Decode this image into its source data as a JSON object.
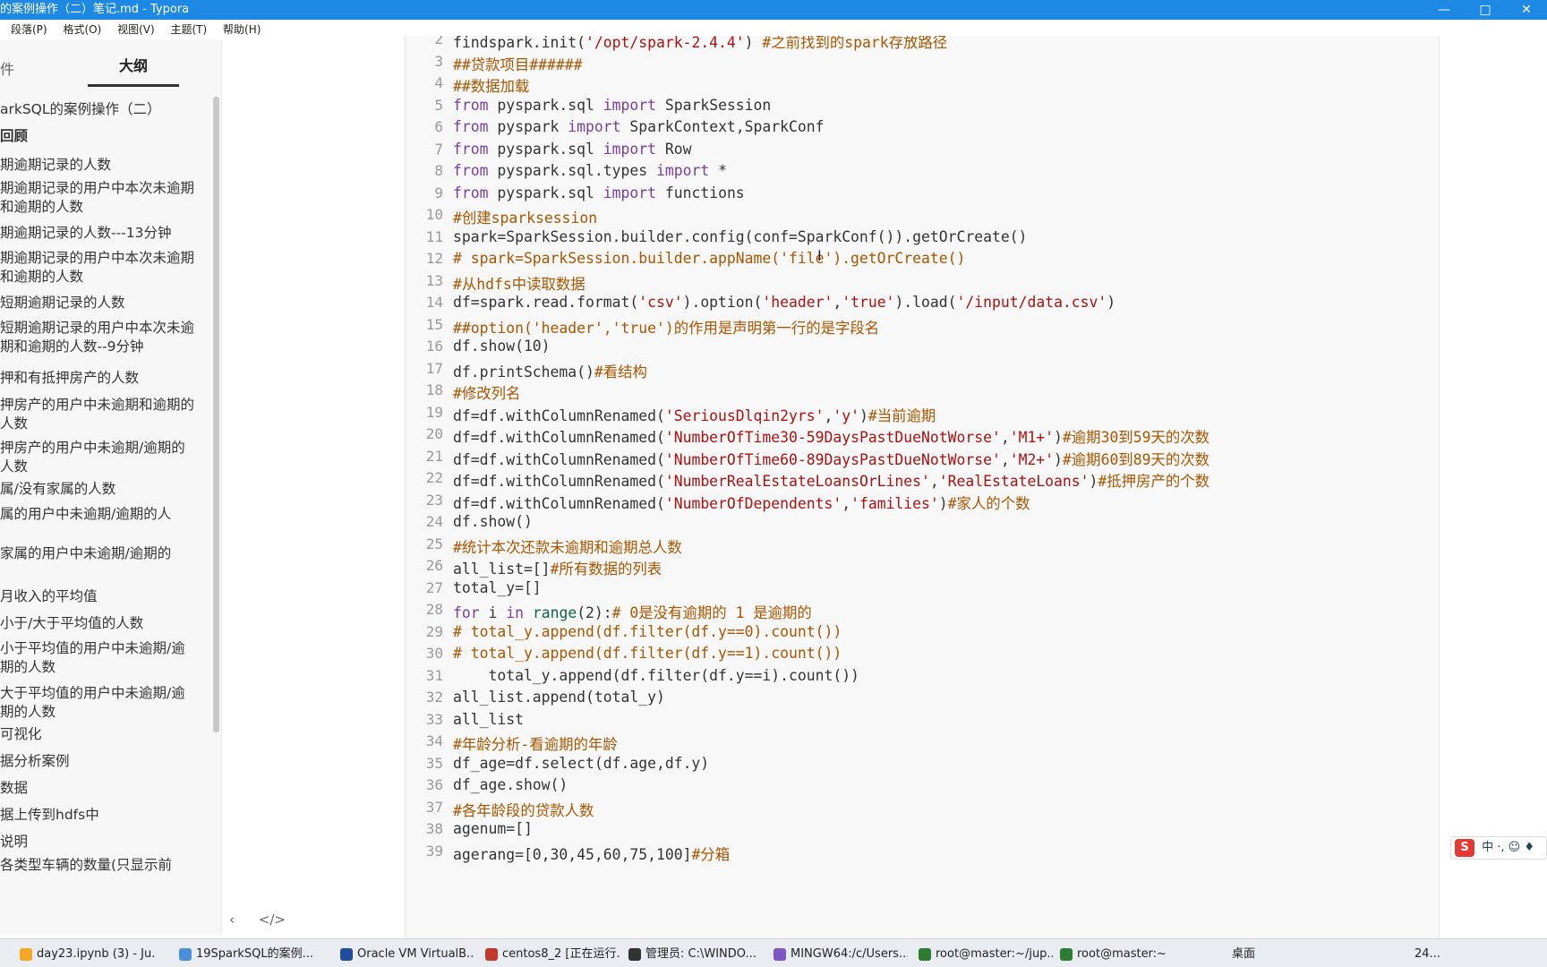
{
  "window": {
    "title": "的案例操作（二）笔记.md - Typora",
    "controls": [
      "—",
      "□",
      "✕"
    ]
  },
  "menu": [
    "段落(P)",
    "格式(O)",
    "视图(V)",
    "主题(T)",
    "帮助(H)"
  ],
  "sidebar": {
    "tab_files": "件",
    "tab_outline": "大纲",
    "items": [
      "arkSQL的案例操作（二）",
      "回顾",
      "期逾期记录的人数",
      "期逾期记录的用户中本次未逾期和逾期的人数",
      "期逾期记录的人数---13分钟",
      "期逾期记录的用户中本次未逾期和逾期的人数",
      "短期逾期记录的人数",
      "短期逾期记录的用户中本次未逾期和逾期的人数--9分钟",
      "押和有抵押房产的人数",
      "押房产的用户中未逾期和逾期的人数",
      "押房产的用户中未逾期/逾期的人数",
      "属/没有家属的人数",
      "属的用户中未逾期/逾期的人",
      "家属的用户中未逾期/逾期的",
      "月收入的平均值",
      "小于/大于平均值的人数",
      "小于平均值的用户中未逾期/逾期的人数",
      "大于平均值的用户中未逾期/逾期的人数",
      "可视化",
      "据分析案例",
      "数据",
      "据上传到hdfs中",
      "说明",
      "各类型车辆的数量(只显示前"
    ],
    "bottom_left": "‹",
    "bottom_source": "</>"
  },
  "editor": {
    "lines": [
      {
        "n": "2",
        "t": "findspark.init('/opt/spark-2.4.4') #之前找到的spark存放路径"
      },
      {
        "n": "3",
        "t": "##贷款项目######"
      },
      {
        "n": "4",
        "t": "##数据加载"
      },
      {
        "n": "5",
        "t": "from pyspark.sql import SparkSession"
      },
      {
        "n": "6",
        "t": "from pyspark import SparkContext,SparkConf"
      },
      {
        "n": "7",
        "t": "from pyspark.sql import Row"
      },
      {
        "n": "8",
        "t": "from pyspark.sql.types import *"
      },
      {
        "n": "9",
        "t": "from pyspark.sql import functions"
      },
      {
        "n": "10",
        "t": "#创建sparksession"
      },
      {
        "n": "11",
        "t": "spark=SparkSession.builder.config(conf=SparkConf()).getOrCreate()"
      },
      {
        "n": "12",
        "t": "# spark=SparkSession.builder.appName('file').getOrCreate()"
      },
      {
        "n": "13",
        "t": "#从hdfs中读取数据"
      },
      {
        "n": "14",
        "t": "df=spark.read.format('csv').option('header','true').load('/input/data.csv')"
      },
      {
        "n": "15",
        "t": "##option('header','true')的作用是声明第一行的是字段名"
      },
      {
        "n": "16",
        "t": "df.show(10)"
      },
      {
        "n": "17",
        "t": "df.printSchema()#看结构"
      },
      {
        "n": "18",
        "t": "#修改列名"
      },
      {
        "n": "19",
        "t": "df=df.withColumnRenamed('SeriousDlqin2yrs','y')#当前逾期"
      },
      {
        "n": "20",
        "t": "df=df.withColumnRenamed('NumberOfTime30-59DaysPastDueNotWorse','M1+')#逾期30到59天的次数"
      },
      {
        "n": "21",
        "t": "df=df.withColumnRenamed('NumberOfTime60-89DaysPastDueNotWorse','M2+')#逾期60到89天的次数"
      },
      {
        "n": "22",
        "t": "df=df.withColumnRenamed('NumberRealEstateLoansOrLines','RealEstateLoans')#抵押房产的个数"
      },
      {
        "n": "23",
        "t": "df=df.withColumnRenamed('NumberOfDependents','families')#家人的个数"
      },
      {
        "n": "24",
        "t": "df.show()"
      },
      {
        "n": "25",
        "t": "#统计本次还款未逾期和逾期总人数"
      },
      {
        "n": "26",
        "t": "all_list=[]#所有数据的列表"
      },
      {
        "n": "27",
        "t": "total_y=[]"
      },
      {
        "n": "28",
        "t": "for i in range(2):# 0是没有逾期的 1 是逾期的"
      },
      {
        "n": "29",
        "t": "# total_y.append(df.filter(df.y==0).count())"
      },
      {
        "n": "30",
        "t": "# total_y.append(df.filter(df.y==1).count())"
      },
      {
        "n": "31",
        "t": "    total_y.append(df.filter(df.y==i).count())"
      },
      {
        "n": "32",
        "t": "all_list.append(total_y)"
      },
      {
        "n": "33",
        "t": "all_list"
      },
      {
        "n": "34",
        "t": "#年龄分析-看逾期的年龄"
      },
      {
        "n": "35",
        "t": "df_age=df.select(df.age,df.y)"
      },
      {
        "n": "36",
        "t": "df_age.show()"
      },
      {
        "n": "37",
        "t": "#各年龄段的贷款人数"
      },
      {
        "n": "38",
        "t": "agenum=[]"
      },
      {
        "n": "39",
        "t": "agerang=[0,30,45,60,75,100]#分箱"
      }
    ]
  },
  "ime": {
    "logo": "S",
    "text": "中 ·, ☺ ♦"
  },
  "taskbar": {
    "items": [
      "day23.ipynb (3) - Ju...",
      "19SparkSQL的案例...",
      "Oracle VM VirtualB...",
      "centos8_2 [正在运行...",
      "管理员: C:\\WINDO...",
      "MINGW64:/c/Users...",
      "root@master:~/jup...",
      "root@master:~"
    ],
    "desktop": "桌面",
    "tray_text": "24..."
  }
}
